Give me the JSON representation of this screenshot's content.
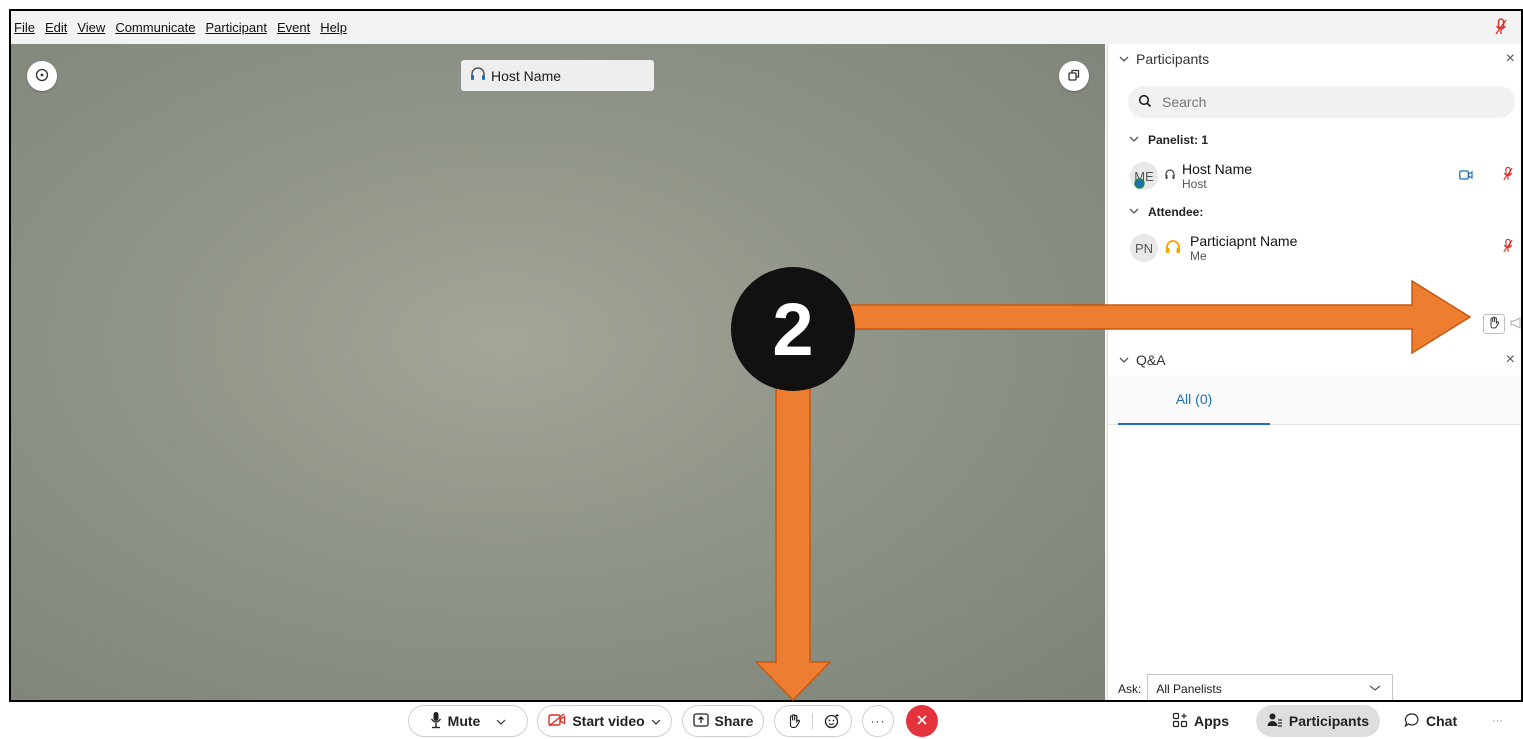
{
  "menu": {
    "items": [
      {
        "label": "File"
      },
      {
        "label": "Edit"
      },
      {
        "label": "View"
      },
      {
        "label": "Communicate"
      },
      {
        "label": "Participant"
      },
      {
        "label": "Event"
      },
      {
        "label": "Help"
      }
    ]
  },
  "video": {
    "host_label": "Host Name"
  },
  "participants_panel": {
    "title": "Participants",
    "search_placeholder": "Search",
    "panelist_group": "Panelist: 1",
    "attendee_group": "Attendee:",
    "host": {
      "initials": "ME",
      "name": "Host Name",
      "role": "Host"
    },
    "attendee": {
      "initials": "PN",
      "name": "Particiapnt Name",
      "role": "Me"
    }
  },
  "qa_panel": {
    "title": "Q&A",
    "tab_all": "All (0)",
    "ask_label": "Ask:",
    "ask_value": "All Panelists"
  },
  "toolbar": {
    "mute_label": "Mute",
    "start_video_label": "Start video",
    "share_label": "Share",
    "apps_label": "Apps",
    "participants_label": "Participants",
    "chat_label": "Chat"
  },
  "annotation": {
    "step_number": "2",
    "arrow_color": "#ED7D31"
  },
  "colors": {
    "accent": "#1c6fb6",
    "muted_mic": "#d93025",
    "end_call": "#e5333d"
  }
}
